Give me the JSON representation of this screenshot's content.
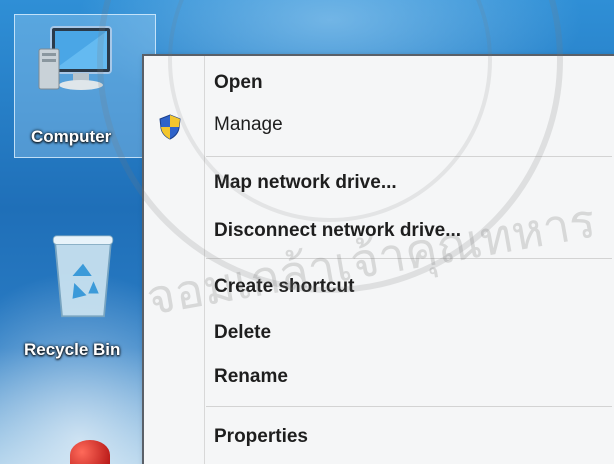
{
  "desktop": {
    "icons": [
      {
        "label": "Computer",
        "icon": "computer-icon"
      },
      {
        "label": "Recycle Bin",
        "icon": "recycle-bin-icon"
      }
    ]
  },
  "context_menu": {
    "items": [
      {
        "label": "Open",
        "bold": true
      },
      {
        "label": "Manage",
        "icon": "uac-shield-icon"
      },
      {
        "label": "Map network drive..."
      },
      {
        "label": "Disconnect network drive..."
      },
      {
        "label": "Create shortcut"
      },
      {
        "label": "Delete"
      },
      {
        "label": "Rename"
      },
      {
        "label": "Properties"
      }
    ]
  },
  "watermark": {
    "text": "จอมเกล้าเจ้าคุณทหาร"
  }
}
